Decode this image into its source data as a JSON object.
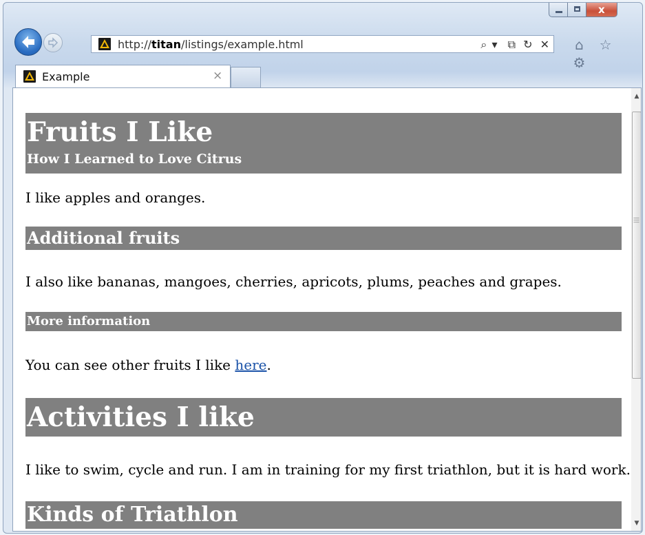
{
  "browser": {
    "url_prefix": "http://",
    "url_host": "titan",
    "url_path": "/listings/example.html",
    "tab_title": "Example",
    "tab_close": "×",
    "window_close": "x",
    "address_tools": {
      "search": "⌕",
      "dropdown": "▾",
      "compat": "⧉",
      "refresh": "↻",
      "stop": "✕"
    },
    "toolbar_icons": [
      "home-icon",
      "favorites-star-icon",
      "tools-gear-icon"
    ],
    "accent": "#2a6dc2",
    "close_color": "#c9503a"
  },
  "page": {
    "heading_bar_color": "#808080",
    "fruits_heading": "Fruits I Like",
    "fruits_subheading": "How I Learned to Love Citrus",
    "para1": "I like apples and oranges.",
    "additional_heading": "Additional fruits",
    "para2": "I also like bananas, mangoes, cherries, apricots, plums, peaches and grapes.",
    "more_info_heading": "More information",
    "para3_before": "You can see other fruits I like ",
    "para3_link": "here",
    "para3_after": ".",
    "activities_heading": "Activities I like",
    "para4": "I like to swim, cycle and run. I am in training for my first triathlon, but it is hard work.",
    "kinds_heading": "Kinds of Triathlon"
  }
}
